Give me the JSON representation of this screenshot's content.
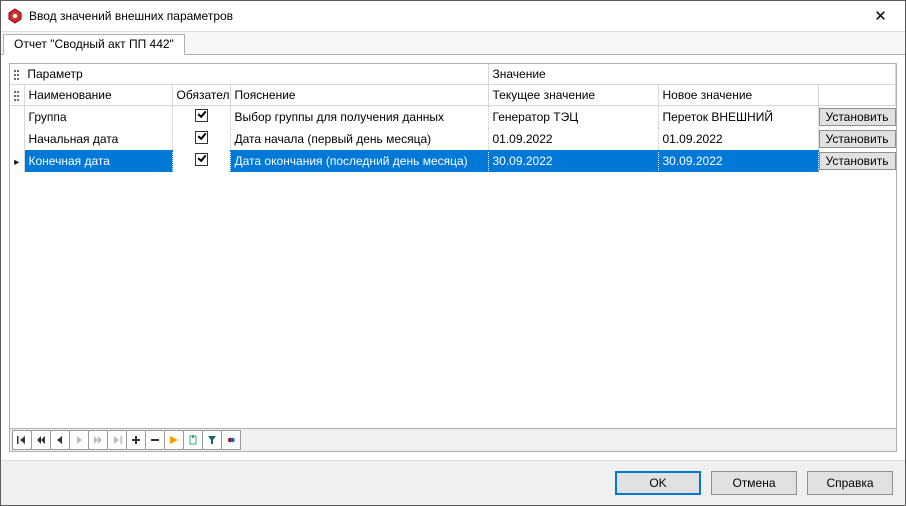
{
  "window": {
    "title": "Ввод значений внешних параметров"
  },
  "tab": {
    "label": "Отчет \"Сводный акт ПП 442\""
  },
  "grid": {
    "band_parameter": "Параметр",
    "band_value": "Значение",
    "col_name": "Наименование",
    "col_required": "Обязательный",
    "col_desc": "Пояснение",
    "col_current": "Текущее значение",
    "col_new": "Новое значение",
    "set_label": "Установить",
    "rows": [
      {
        "name": "Группа",
        "required": true,
        "desc": "Выбор группы для получения данных",
        "current": "Генератор ТЭЦ",
        "new": "Переток ВНЕШНИЙ",
        "selected": false
      },
      {
        "name": "Начальная дата",
        "required": true,
        "desc": "Дата начала (первый день месяца)",
        "current": "01.09.2022",
        "new": "01.09.2022",
        "selected": false
      },
      {
        "name": "Конечная дата",
        "required": true,
        "desc": "Дата окончания (последний день месяца)",
        "current": "30.09.2022",
        "new": "30.09.2022",
        "selected": true
      }
    ]
  },
  "footer": {
    "ok": "OK",
    "cancel": "Отмена",
    "help": "Справка"
  }
}
